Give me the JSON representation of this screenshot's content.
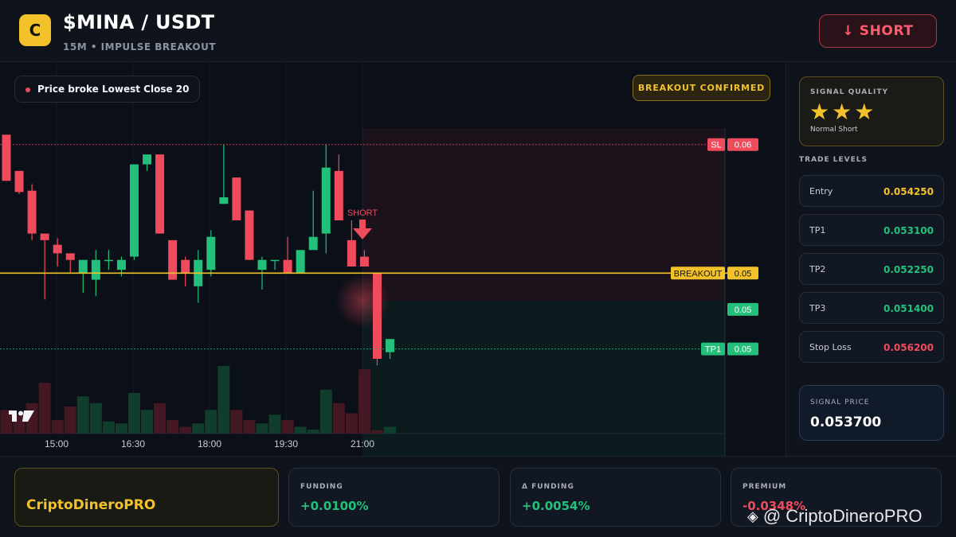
{
  "header": {
    "logo_letter": "C",
    "pair": "$MINA / USDT",
    "subtitle": "15M • IMPULSE BREAKOUT",
    "short_button": "↓ SHORT"
  },
  "chart": {
    "info_pill": "Price broke Lowest Close 20",
    "confirm_badge": "BREAKOUT CONFIRMED",
    "signal_label": "SHORT",
    "line_labels": {
      "sl": "SL",
      "sl_value": "0.06",
      "breakout": "BREAKOUT",
      "breakout_value": "0.05",
      "price_value": "0.05",
      "tp1": "TP1",
      "tp1_value": "0.05"
    },
    "colors": {
      "up": "#22c07a",
      "down": "#f04a5d",
      "breakout": "#f3c22b"
    }
  },
  "chart_data": {
    "type": "candlestick",
    "x_ticks": [
      "15:00",
      "16:30",
      "18:00",
      "19:30",
      "21:00"
    ],
    "levels": {
      "sl": 0.0562,
      "breakout": 0.05425,
      "tp1": 0.0531,
      "last": 0.0537
    },
    "ylim": [
      0.05295,
      0.05645
    ],
    "candles": [
      {
        "o": 0.05635,
        "h": 0.05635,
        "l": 0.05565,
        "c": 0.05565
      },
      {
        "o": 0.0558,
        "h": 0.0558,
        "l": 0.05545,
        "c": 0.05548
      },
      {
        "o": 0.0555,
        "h": 0.0556,
        "l": 0.05475,
        "c": 0.05485
      },
      {
        "o": 0.05485,
        "h": 0.05475,
        "l": 0.05385,
        "c": 0.05475
      },
      {
        "o": 0.05468,
        "h": 0.05478,
        "l": 0.05435,
        "c": 0.05455
      },
      {
        "o": 0.05455,
        "h": 0.05455,
        "l": 0.05425,
        "c": 0.05445
      },
      {
        "o": 0.05425,
        "h": 0.05435,
        "l": 0.05395,
        "c": 0.05445
      },
      {
        "o": 0.05415,
        "h": 0.0546,
        "l": 0.0539,
        "c": 0.05445
      },
      {
        "o": 0.05445,
        "h": 0.0546,
        "l": 0.0543,
        "c": 0.05445
      },
      {
        "o": 0.0543,
        "h": 0.0545,
        "l": 0.0542,
        "c": 0.05445
      },
      {
        "o": 0.0545,
        "h": 0.0559,
        "l": 0.05445,
        "c": 0.0559
      },
      {
        "o": 0.0559,
        "h": 0.05605,
        "l": 0.0558,
        "c": 0.05605
      },
      {
        "o": 0.05605,
        "h": 0.05605,
        "l": 0.05485,
        "c": 0.05485
      },
      {
        "o": 0.05475,
        "h": 0.05475,
        "l": 0.05415,
        "c": 0.05415
      },
      {
        "o": 0.05445,
        "h": 0.0545,
        "l": 0.05405,
        "c": 0.05425
      },
      {
        "o": 0.05405,
        "h": 0.0546,
        "l": 0.0538,
        "c": 0.05445
      },
      {
        "o": 0.0543,
        "h": 0.0549,
        "l": 0.0542,
        "c": 0.0548
      },
      {
        "o": 0.0553,
        "h": 0.0562,
        "l": 0.0553,
        "c": 0.0554
      },
      {
        "o": 0.0557,
        "h": 0.0557,
        "l": 0.05505,
        "c": 0.05505
      },
      {
        "o": 0.0552,
        "h": 0.0552,
        "l": 0.05445,
        "c": 0.05445
      },
      {
        "o": 0.0543,
        "h": 0.0545,
        "l": 0.054,
        "c": 0.05445
      },
      {
        "o": 0.05445,
        "h": 0.05445,
        "l": 0.0543,
        "c": 0.05445
      },
      {
        "o": 0.05445,
        "h": 0.0548,
        "l": 0.05425,
        "c": 0.05425
      },
      {
        "o": 0.05425,
        "h": 0.0546,
        "l": 0.05425,
        "c": 0.0546
      },
      {
        "o": 0.0546,
        "h": 0.0555,
        "l": 0.0548,
        "c": 0.0548
      },
      {
        "o": 0.05485,
        "h": 0.0562,
        "l": 0.05455,
        "c": 0.05585
      },
      {
        "o": 0.0558,
        "h": 0.05605,
        "l": 0.05505,
        "c": 0.05505
      },
      {
        "o": 0.05475,
        "h": 0.05505,
        "l": 0.05435,
        "c": 0.05435
      },
      {
        "o": 0.0545,
        "h": 0.0546,
        "l": 0.05435,
        "c": 0.05435
      },
      {
        "o": 0.05425,
        "h": 0.05425,
        "l": 0.05285,
        "c": 0.05295
      },
      {
        "o": 0.05305,
        "h": 0.05325,
        "l": 0.05295,
        "c": 0.05325
      }
    ],
    "volumes": [
      0.35,
      0.3,
      0.45,
      0.75,
      0.2,
      0.4,
      0.55,
      0.45,
      0.18,
      0.15,
      0.6,
      0.35,
      0.45,
      0.2,
      0.1,
      0.15,
      0.35,
      1.0,
      0.35,
      0.2,
      0.15,
      0.28,
      0.2,
      0.1,
      0.06,
      0.65,
      0.45,
      0.3,
      0.95,
      0.05,
      0.1
    ]
  },
  "sidebar": {
    "quality_label": "SIGNAL QUALITY",
    "stars": "★★★",
    "quality_sub": "Normal Short",
    "levels_title": "TRADE LEVELS",
    "levels": [
      {
        "name": "Entry",
        "value": "0.054250",
        "color": "#f3c22b"
      },
      {
        "name": "TP1",
        "value": "0.053100",
        "color": "#22c07a"
      },
      {
        "name": "TP2",
        "value": "0.052250",
        "color": "#22c07a"
      },
      {
        "name": "TP3",
        "value": "0.051400",
        "color": "#22c07a"
      },
      {
        "name": "Stop Loss",
        "value": "0.056200",
        "color": "#f04a5d"
      }
    ],
    "signal_price_label": "SIGNAL PRICE",
    "signal_price": "0.053700"
  },
  "footer": {
    "brand": "CriptoDineroPRO",
    "metrics": [
      {
        "label": "FUNDING",
        "value": "+0.0100%",
        "color": "#22c07a"
      },
      {
        "label": "Δ FUNDING",
        "value": "+0.0054%",
        "color": "#22c07a"
      },
      {
        "label": "PREMIUM",
        "value": "-0.0348%",
        "color": "#f04a5d"
      }
    ],
    "watermark": "@ CriptoDineroPRO"
  }
}
